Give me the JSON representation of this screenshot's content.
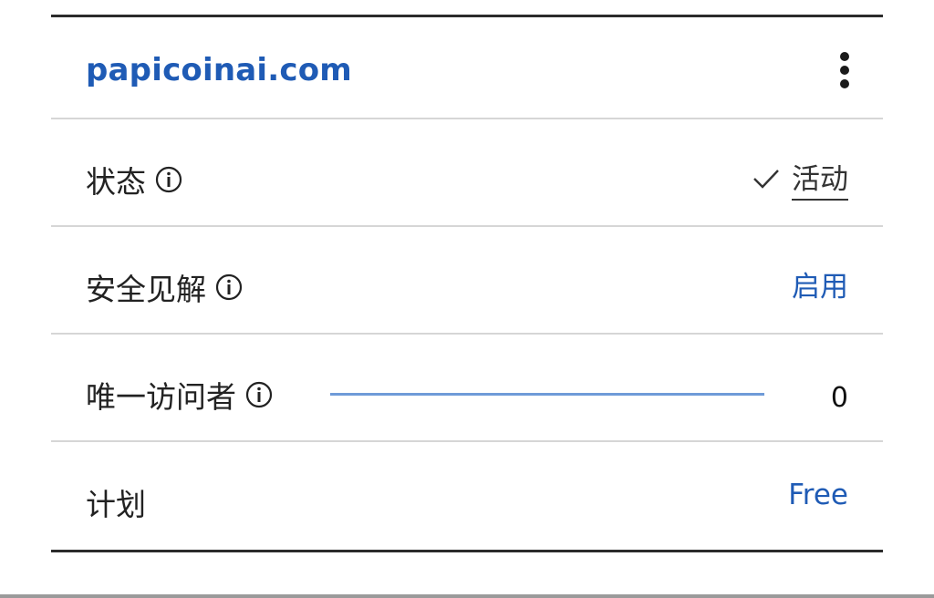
{
  "header": {
    "domain": "papicoinai.com",
    "menu_icon": "more-vertical-icon"
  },
  "rows": {
    "status": {
      "label": "状态",
      "info_icon": "info-icon",
      "value": "活动",
      "value_icon": "check-icon"
    },
    "security": {
      "label": "安全见解",
      "info_icon": "info-icon",
      "value": "启用"
    },
    "visitors": {
      "label": "唯一访问者",
      "info_icon": "info-icon",
      "value": "0"
    },
    "plan": {
      "label": "计划",
      "value": "Free"
    }
  },
  "colors": {
    "link_blue": "#1f5bb5",
    "sparkline_blue": "#6f9bd8",
    "divider": "#d6d6d6"
  }
}
